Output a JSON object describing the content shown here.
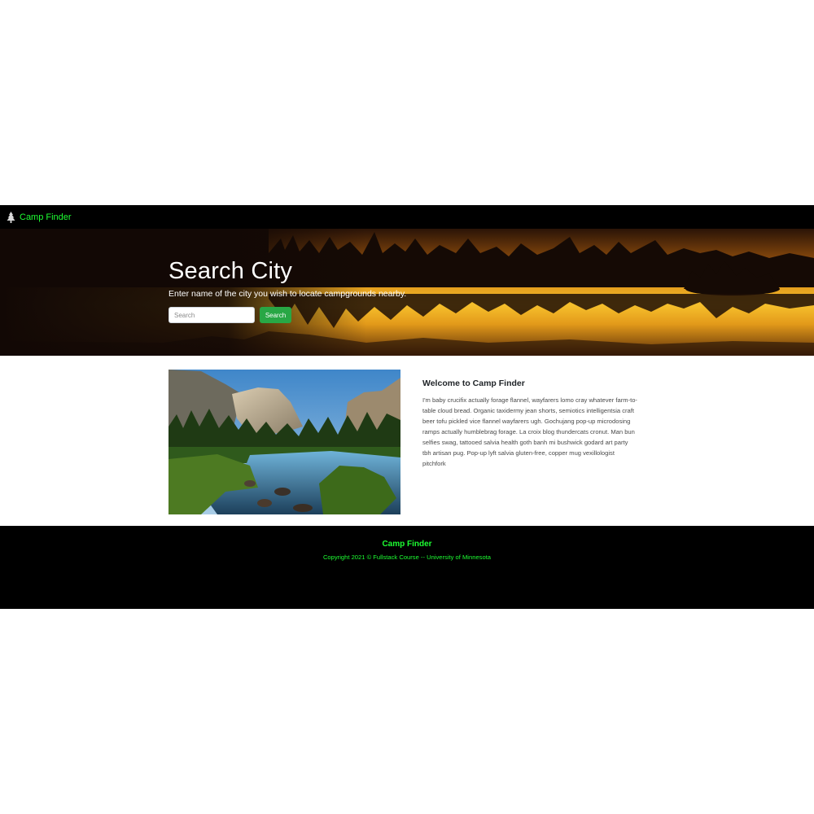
{
  "navbar": {
    "brand_icon": "tree-icon",
    "brand_label": "Camp Finder"
  },
  "hero": {
    "background": "lake-sunset-image",
    "title": "Search City",
    "subtitle": "Enter name of the city you wish to locate campgrounds nearby.",
    "search_placeholder": "Search",
    "search_button": "Search"
  },
  "main": {
    "image": "mountain-valley-river-image",
    "welcome_title": "Welcome to Camp Finder",
    "welcome_text": "I'm baby crucifix actually forage flannel, wayfarers lomo cray whatever farm-to-table cloud bread. Organic taxidermy jean shorts, semiotics intelligentsia craft beer tofu pickled vice flannel wayfarers ugh. Gochujang pop-up microdosing ramps actually humblebrag forage. La croix blog thundercats cronut. Man bun selfies swag, tattooed salvia health goth banh mi bushwick godard art party tbh artisan pug. Pop-up lyft salvia gluten-free, copper mug vexillologist pitchfork"
  },
  "footer": {
    "title": "Camp Finder",
    "copyright": "Copyright 2021 © Fullstack Course -- University of Minnesota"
  },
  "colors": {
    "brand_green": "#1dff32",
    "button_green": "#28a745",
    "nav_background": "#000000"
  }
}
